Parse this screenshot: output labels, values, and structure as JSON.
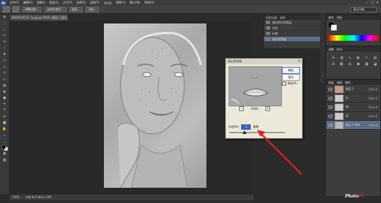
{
  "app": {
    "logo": "Ps"
  },
  "menubar": {
    "items": [
      "文件(F)",
      "编辑(E)",
      "图像(I)",
      "图层(L)",
      "文字(Y)",
      "选择(S)",
      "滤镜(T)",
      "3D(D)",
      "视图(V)",
      "窗口(W)",
      "帮助(H)"
    ],
    "window_controls": [
      "−",
      "□",
      "×"
    ]
  },
  "options_bar": {
    "buttons": [
      "调整边缘...",
      "选择并遮住...",
      "选区...",
      "羽化..."
    ],
    "workspace": "基本功能"
  },
  "document": {
    "tab_title": "0929143112_5.jpg @ 100% (图层 1 副本, RGB/8)",
    "status_zoom": "100%",
    "status_doc": "文档:825.8K/2.13M"
  },
  "history_panel": {
    "tabs": [
      "历史记录",
      "动作"
    ],
    "items": [
      {
        "label": "通过拷贝的图层",
        "selected": false
      },
      {
        "label": "去色",
        "selected": false
      },
      {
        "label": "反相",
        "selected": false
      },
      {
        "label": "高反差保留",
        "selected": true
      }
    ]
  },
  "color_panel": {
    "tabs": [
      "颜色",
      "色板"
    ]
  },
  "adjustments_panel": {
    "tabs": [
      "调整",
      "样式"
    ]
  },
  "layers_panel": {
    "tabs": [
      "图层",
      "通道",
      "路径"
    ],
    "layers": [
      {
        "name": "图层 1",
        "shortcut": "Ctrl+4",
        "selected": false
      },
      {
        "name": "红",
        "shortcut": "Ctrl+3",
        "selected": false
      },
      {
        "name": "绿",
        "shortcut": "Ctrl+4",
        "selected": false
      },
      {
        "name": "蓝",
        "shortcut": "Ctrl+5",
        "selected": false
      },
      {
        "name": "图层 1 副本",
        "shortcut": "Ctrl+6",
        "selected": true
      }
    ]
  },
  "dialog": {
    "title": "高反差保留",
    "close": "×",
    "ok_label": "确定",
    "reset_label": "复位",
    "preview_label": "预览(P)",
    "preview_checked": true,
    "zoom_minus": "−",
    "zoom_plus": "+",
    "zoom_level": "100%",
    "radius_label": "半径(R):",
    "radius_value": "1",
    "radius_unit": "像素",
    "slider_fraction": 0.28
  },
  "watermark": {
    "text": "Photo",
    "accent": "Ps"
  },
  "colors": {
    "accent": "#d92020",
    "selection": "#5a6e88"
  }
}
